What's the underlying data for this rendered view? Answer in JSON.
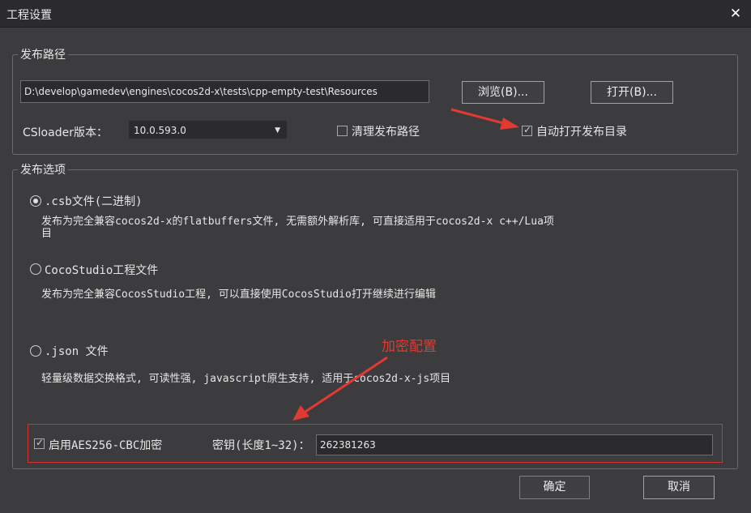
{
  "window": {
    "title": "工程设置"
  },
  "publish_path": {
    "legend": "发布路径",
    "path_value": "D:\\develop\\gamedev\\engines\\cocos2d-x\\tests\\cpp-empty-test\\Resources",
    "browse_label": "浏览(B)...",
    "open_label": "打开(B)...",
    "csloader_label": "CSloader版本：",
    "csloader_value": "10.0.593.0",
    "clean_label": "清理发布路径",
    "clean_checked": false,
    "auto_open_label": "自动打开发布目录",
    "auto_open_checked": true
  },
  "publish_options": {
    "legend": "发布选项",
    "csb": {
      "label": ".csb文件(二进制)",
      "desc_line1": "发布为完全兼容cocos2d-x的flatbuffers文件, 无需额外解析库, 可直接适用于cocos2d-x c++/Lua项",
      "desc_line2": "目",
      "selected": true
    },
    "ccs": {
      "label": "CocoStudio工程文件",
      "desc": "发布为完全兼容CocosStudio工程, 可以直接使用CocosStudio打开继续进行编辑",
      "selected": false
    },
    "json": {
      "label": ".json 文件",
      "desc": "轻量级数据交换格式, 可读性强, javascript原生支持, 适用于cocos2d-x-js项目",
      "selected": false
    },
    "aes_label": "启用AES256-CBC加密",
    "aes_checked": true,
    "key_label": "密钥(长度1~32)：",
    "key_value": "262381263"
  },
  "annotation": {
    "text": "加密配置",
    "color": "#e03a31"
  },
  "footer": {
    "ok_label": "确定",
    "cancel_label": "取消"
  }
}
